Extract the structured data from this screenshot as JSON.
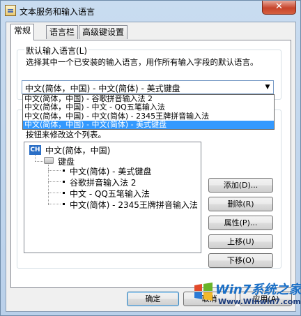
{
  "window": {
    "title": "文本服务和输入语言",
    "close_glyph": "✕"
  },
  "tabs": [
    {
      "label": "常规",
      "active": true
    },
    {
      "label": "语言栏",
      "active": false
    },
    {
      "label": "高级键设置",
      "active": false
    }
  ],
  "default_language": {
    "group_label": "默认输入语言(L)",
    "description": "选择其中一个已安装的输入语言，用作所有输入字段的默认语言。",
    "selected_value": "中文(简体，中国) - 中文(简体) - 美式键盘",
    "options": [
      "中文(简体，中国) - 谷歌拼音输入法 2",
      "中文(简体，中国) - 中文 - QQ五笔输入法",
      "中文(简体，中国) - 中文(简体) - 2345王牌拼音输入法",
      "中文(简体，中国) - 中文(简体) - 美式键盘"
    ],
    "selected_index": 3
  },
  "installed_services": {
    "partial_instruction": "按钮来修改这个列表。",
    "tree": {
      "language_badge": "CH",
      "language": "中文(简体，中国)",
      "category": "键盘",
      "items": [
        "中文(简体) - 美式键盘",
        "谷歌拼音输入法 2",
        "中文 - QQ五笔输入法",
        "中文(简体) - 2345王牌拼音输入法"
      ]
    }
  },
  "side_buttons": {
    "add": "添加(D)...",
    "remove": "删除(R)",
    "properties": "属性(P)...",
    "move_up": "上移(U)",
    "move_down": "下移(O)"
  },
  "footer": {
    "ok": "确定",
    "cancel": "取消",
    "apply": "应用(A)"
  },
  "watermark": {
    "title": "Win7系统之家",
    "url": "Www.Winwin7.com"
  }
}
